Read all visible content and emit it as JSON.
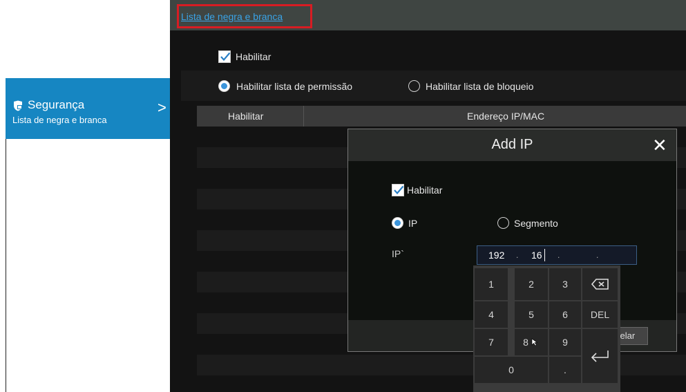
{
  "sidebar": {
    "item": {
      "title": "Segurança",
      "subtitle": "Lista de negra e branca",
      "icon": "shield-lock-icon",
      "chevron": ">"
    }
  },
  "header": {
    "breadcrumb": "Lista de negra e branca"
  },
  "form": {
    "enable_label": "Habilitar",
    "enable_checked": true,
    "allowlist_label": "Habilitar lista de permissão",
    "blocklist_label": "Habilitar lista de bloqueio",
    "selected_mode": "allowlist"
  },
  "table": {
    "columns": [
      "Habilitar",
      "Endereço IP/MAC"
    ]
  },
  "dialog": {
    "title": "Add IP",
    "close": "✕",
    "enable_label": "Habilitar",
    "ip_option": "IP",
    "segment_option": "Segmento",
    "ip_label": "IP`",
    "ip_value": [
      "192",
      "16",
      "",
      ""
    ],
    "cancel_label": "Cancelar",
    "cancel_visible": "celar"
  },
  "keypad": {
    "keys": [
      "1",
      "2",
      "3",
      "⌫",
      "4",
      "5",
      "6",
      "DEL",
      "7",
      "8",
      "9",
      "⏎",
      "0",
      "."
    ]
  },
  "colors": {
    "accent": "#1686c2",
    "highlight": "#d81c23",
    "link": "#3aa3e6",
    "background": "#131313"
  }
}
